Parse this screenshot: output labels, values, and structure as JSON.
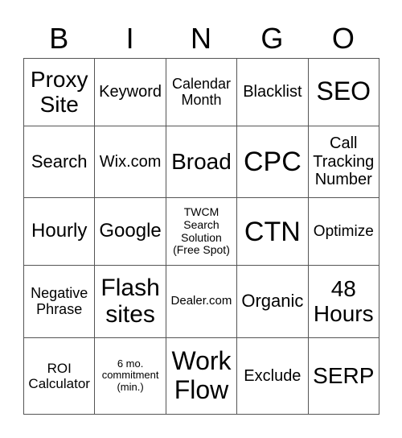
{
  "header": [
    "B",
    "I",
    "N",
    "G",
    "O"
  ],
  "rows": [
    [
      "Proxy Site",
      "Keyword",
      "Calendar Month",
      "Blacklist",
      "SEO"
    ],
    [
      "Search",
      "Wix.com",
      "Broad",
      "CPC",
      "Call Tracking Number"
    ],
    [
      "Hourly",
      "Google",
      "TWCM Search Solution (Free Spot)",
      "CTN",
      "Optimize"
    ],
    [
      "Negative Phrase",
      "Flash sites",
      "Dealer.com",
      "Organic",
      "48 Hours"
    ],
    [
      "ROI Calculator",
      "6 mo. commitment (min.)",
      "Work Flow",
      "Exclude",
      "SERP"
    ]
  ]
}
